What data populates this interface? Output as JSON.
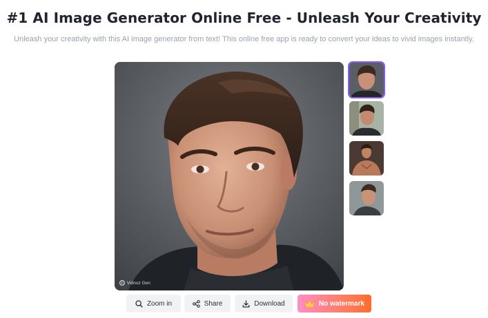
{
  "header": {
    "title": "#1 AI Image Generator Online Free - Unleash Your Creativity",
    "subtitle": "Unleash your creativity with this AI image generator from text! This online free app is ready to convert your ideas to vivid images instantly."
  },
  "preview": {
    "watermark_text": "Vidnoz Gen",
    "watermark_logo": "G"
  },
  "thumbnails": [
    {
      "name": "thumbnail-1",
      "selected": true
    },
    {
      "name": "thumbnail-2",
      "selected": false
    },
    {
      "name": "thumbnail-3",
      "selected": false
    },
    {
      "name": "thumbnail-4",
      "selected": false
    }
  ],
  "actions": {
    "zoom_in": "Zoom in",
    "share": "Share",
    "download": "Download",
    "no_watermark": "No watermark"
  },
  "colors": {
    "selection_border": "#8a5cf6",
    "premium_gradient_start": "#ff8ec3",
    "premium_gradient_end": "#ff6d2e"
  },
  "icons": {
    "zoom": "magnifier-icon",
    "share": "share-icon",
    "download": "download-icon",
    "premium": "crown-icon"
  }
}
